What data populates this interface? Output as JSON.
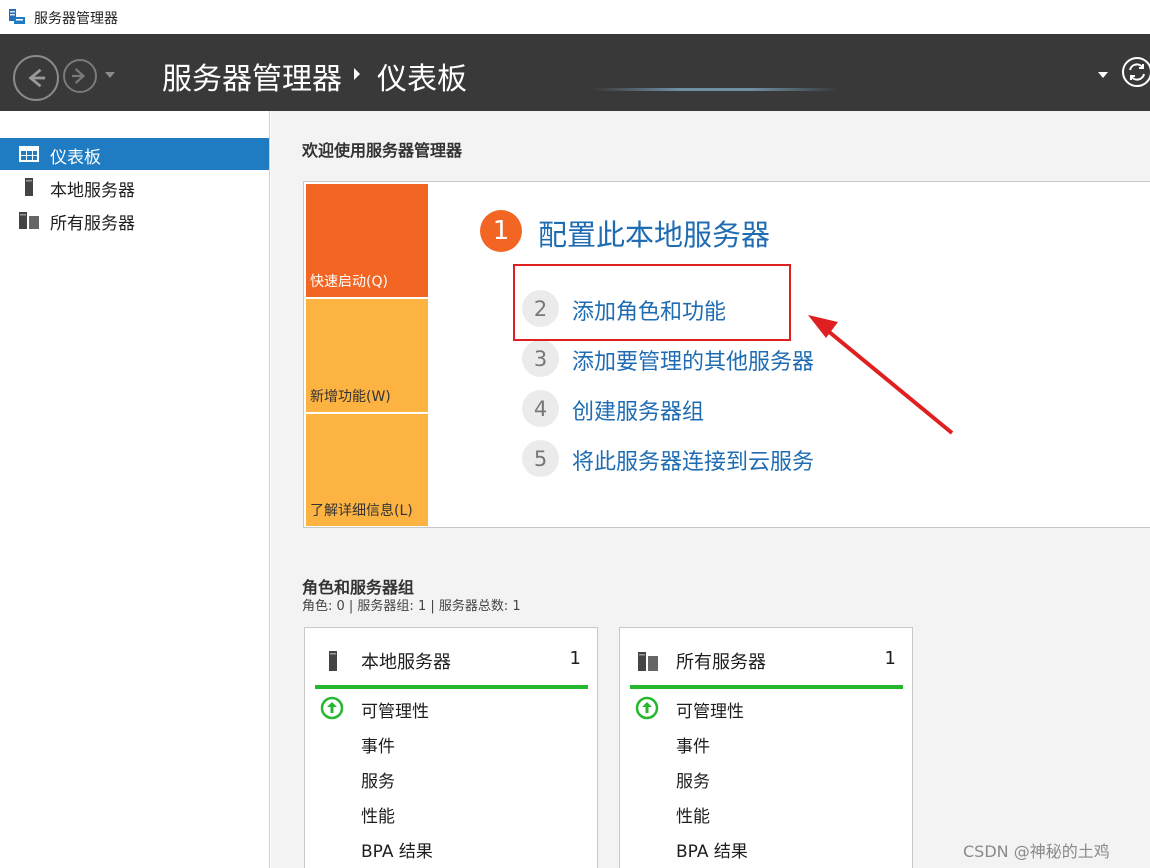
{
  "window": {
    "title": "服务器管理器"
  },
  "header": {
    "breadcrumb_root": "服务器管理器",
    "breadcrumb_current": "仪表板"
  },
  "sidebar": {
    "items": [
      {
        "label": "仪表板",
        "icon": "dashboard-icon",
        "active": true
      },
      {
        "label": "本地服务器",
        "icon": "server-icon",
        "active": false
      },
      {
        "label": "所有服务器",
        "icon": "servers-icon",
        "active": false
      }
    ]
  },
  "welcome": {
    "title": "欢迎使用服务器管理器",
    "tiles": [
      "快速启动(Q)",
      "新增功能(W)",
      "了解详细信息(L)"
    ],
    "step1": {
      "number": "1",
      "label": "配置此本地服务器"
    },
    "steps": [
      {
        "number": "2",
        "label": "添加角色和功能"
      },
      {
        "number": "3",
        "label": "添加要管理的其他服务器"
      },
      {
        "number": "4",
        "label": "创建服务器组"
      },
      {
        "number": "5",
        "label": "将此服务器连接到云服务"
      }
    ]
  },
  "roles": {
    "title": "角色和服务器组",
    "subtitle": "角色: 0 | 服务器组: 1 | 服务器总数: 1",
    "cards": [
      {
        "title": "本地服务器",
        "count": "1",
        "rows": [
          "可管理性",
          "事件",
          "服务",
          "性能",
          "BPA 结果"
        ]
      },
      {
        "title": "所有服务器",
        "count": "1",
        "rows": [
          "可管理性",
          "事件",
          "服务",
          "性能",
          "BPA 结果"
        ]
      }
    ]
  },
  "colors": {
    "accent": "#1f7cc3",
    "orange": "#f26522",
    "amber": "#fcb342",
    "status_green": "#25b82f",
    "annotation_red": "#e02020"
  },
  "watermark": "CSDN @神秘的土鸡"
}
